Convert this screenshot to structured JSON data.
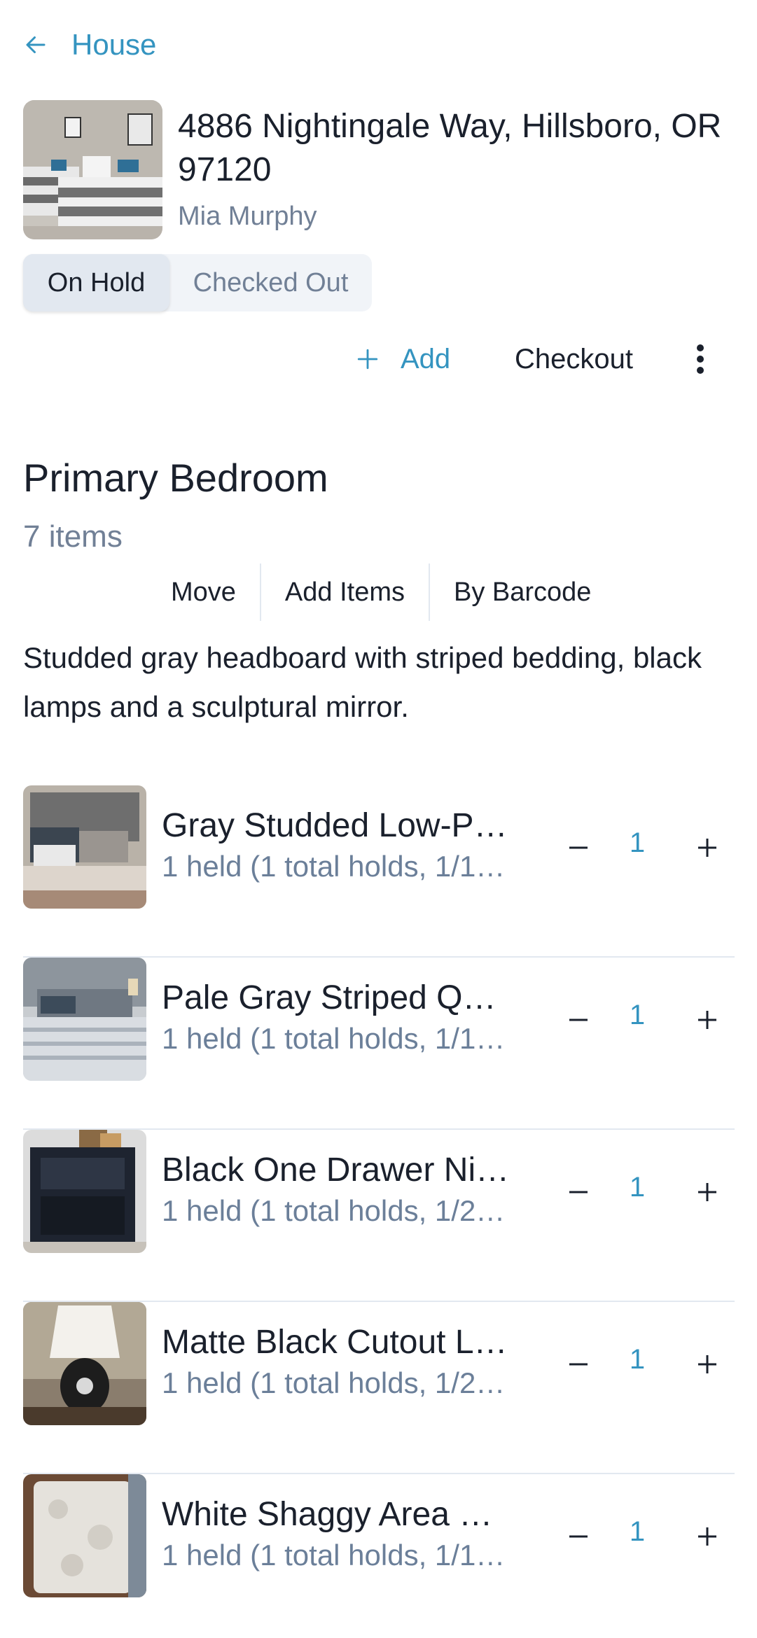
{
  "nav": {
    "back_label": "House"
  },
  "property": {
    "address": "4886 Nightingale Way, Hillsboro, OR 97120",
    "owner": "Mia Murphy"
  },
  "segment": {
    "options": [
      "On Hold",
      "Checked Out"
    ],
    "selected": "On Hold"
  },
  "actions": {
    "add_label": "Add",
    "checkout_label": "Checkout"
  },
  "room": {
    "title": "Primary Bedroom",
    "count": "7 items",
    "actions": [
      "Move",
      "Add Items",
      "By Barcode"
    ],
    "description": "Studded gray headboard with striped bedding, black lamps and a sculptural mirror."
  },
  "items": [
    {
      "name": "Gray Studded Low-P…",
      "status": "1 held (1 total holds, 1/1…",
      "qty": "1"
    },
    {
      "name": "Pale Gray Striped Q…",
      "status": "1 held (1 total holds, 1/1…",
      "qty": "1"
    },
    {
      "name": "Black One Drawer Ni…",
      "status": "1 held (1 total holds, 1/2…",
      "qty": "1"
    },
    {
      "name": "Matte Black Cutout L…",
      "status": "1 held (1 total holds, 1/2…",
      "qty": "1"
    },
    {
      "name": "White Shaggy Area …",
      "status": "1 held (1 total holds, 1/1…",
      "qty": "1"
    }
  ],
  "colors": {
    "accent": "#3494c0",
    "muted": "#718096",
    "divider": "#e2e8f0"
  }
}
